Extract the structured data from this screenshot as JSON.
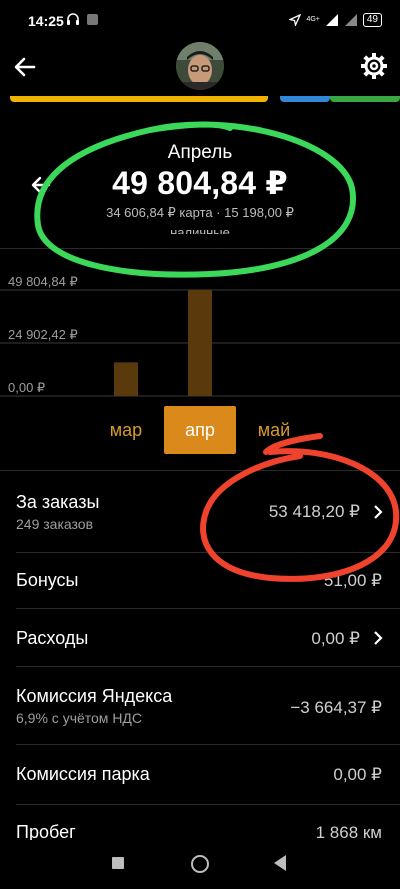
{
  "status_bar": {
    "time": "14:25",
    "network": "4G+",
    "battery": "49"
  },
  "header": {
    "back_icon": "arrow-left-icon",
    "avatar": "user-avatar",
    "settings_icon": "gear-icon"
  },
  "summary": {
    "month": "Апрель",
    "total": "49 804,84 ₽",
    "breakdown": "34 606,84 ₽ карта · 15 198,00 ₽",
    "breakdown_continued": "наличные"
  },
  "chart_data": {
    "type": "bar",
    "categories": [
      "мар",
      "апр",
      "май"
    ],
    "values": [
      15800,
      49804.84,
      0
    ],
    "tick_labels": [
      "49 804,84 ₽",
      "24 902,42 ₽",
      "0,00 ₽"
    ],
    "ylim": [
      0,
      49804.84
    ],
    "bar_color": "#5a3a0c"
  },
  "month_selector": {
    "items": [
      "мар",
      "апр",
      "май"
    ],
    "selected": "апр",
    "accent_color": "#d98a1a"
  },
  "rows": {
    "orders": {
      "label": "За заказы",
      "sub": "249 заказов",
      "value": "53 418,20 ₽"
    },
    "bonus": {
      "label": "Бонусы",
      "value": "51,00 ₽"
    },
    "expenses": {
      "label": "Расходы",
      "value": "0,00 ₽"
    },
    "yandex_fee": {
      "label": "Комиссия Яндекса",
      "sub": "6,9% с учётом НДС",
      "value": "−3 664,37 ₽"
    },
    "park_fee": {
      "label": "Комиссия парка",
      "value": "0,00 ₽"
    },
    "mileage": {
      "label": "Пробег",
      "value": "1 868 км"
    }
  }
}
